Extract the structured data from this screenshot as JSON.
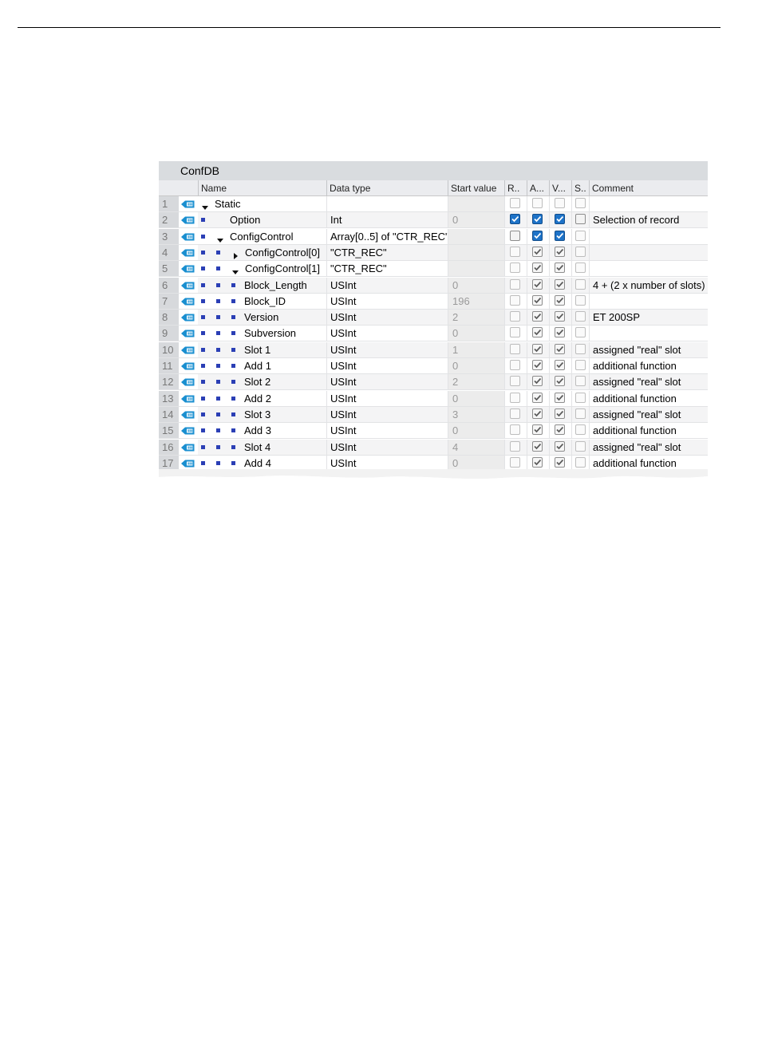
{
  "db": {
    "title": "ConfDB",
    "columns": {
      "name": "Name",
      "data_type": "Data type",
      "start_value": "Start value",
      "c1": "R..",
      "c2": "A...",
      "c3": "V...",
      "c4": "S..",
      "comment": "Comment"
    },
    "rows": [
      {
        "num": "1",
        "name": "Static",
        "dtype": "",
        "start": "",
        "comment": "",
        "level": 0,
        "expand": "down",
        "bullet": false,
        "checks": [
          "off",
          "off",
          "off",
          "off"
        ]
      },
      {
        "num": "2",
        "name": "Option",
        "dtype": "Int",
        "start": "0",
        "comment": "Selection of record",
        "level": 1,
        "expand": "none",
        "bullet": true,
        "checks": [
          "blue",
          "blue",
          "blue",
          "active-off"
        ]
      },
      {
        "num": "3",
        "name": "ConfigControl",
        "dtype": "Array[0..5] of \"CTR_REC\"",
        "start": "",
        "comment": "",
        "level": 1,
        "expand": "down",
        "bullet": true,
        "checks": [
          "active-off",
          "blue",
          "blue",
          "off"
        ]
      },
      {
        "num": "4",
        "name": "ConfigControl[0]",
        "dtype": "\"CTR_REC\"",
        "start": "",
        "comment": "",
        "level": 2,
        "expand": "right",
        "bullet": true,
        "checks": [
          "off",
          "gray",
          "gray",
          "off"
        ]
      },
      {
        "num": "5",
        "name": "ConfigControl[1]",
        "dtype": "\"CTR_REC\"",
        "start": "",
        "comment": "",
        "level": 2,
        "expand": "down",
        "bullet": true,
        "checks": [
          "off",
          "gray",
          "gray",
          "off"
        ]
      },
      {
        "num": "6",
        "name": "Block_Length",
        "dtype": "USInt",
        "start": "0",
        "comment": "4 + (2 x number of slots)",
        "level": 3,
        "expand": "none",
        "bullet": true,
        "checks": [
          "off",
          "gray",
          "gray",
          "off"
        ]
      },
      {
        "num": "7",
        "name": "Block_ID",
        "dtype": "USInt",
        "start": "196",
        "comment": "",
        "level": 3,
        "expand": "none",
        "bullet": true,
        "checks": [
          "off",
          "gray",
          "gray",
          "off"
        ]
      },
      {
        "num": "8",
        "name": "Version",
        "dtype": "USInt",
        "start": "2",
        "comment": "ET 200SP",
        "level": 3,
        "expand": "none",
        "bullet": true,
        "checks": [
          "off",
          "gray",
          "gray",
          "off"
        ]
      },
      {
        "num": "9",
        "name": "Subversion",
        "dtype": "USInt",
        "start": "0",
        "comment": "",
        "level": 3,
        "expand": "none",
        "bullet": true,
        "checks": [
          "off",
          "gray",
          "gray",
          "off"
        ]
      },
      {
        "num": "10",
        "name": "Slot 1",
        "dtype": "USInt",
        "start": "1",
        "comment": "assigned \"real\" slot",
        "level": 3,
        "expand": "none",
        "bullet": true,
        "checks": [
          "off",
          "gray",
          "gray",
          "off"
        ]
      },
      {
        "num": "11",
        "name": "Add 1",
        "dtype": "USInt",
        "start": "0",
        "comment": "additional function",
        "level": 3,
        "expand": "none",
        "bullet": true,
        "checks": [
          "off",
          "gray",
          "gray",
          "off"
        ]
      },
      {
        "num": "12",
        "name": "Slot 2",
        "dtype": "USInt",
        "start": "2",
        "comment": "assigned \"real\" slot",
        "level": 3,
        "expand": "none",
        "bullet": true,
        "checks": [
          "off",
          "gray",
          "gray",
          "off"
        ]
      },
      {
        "num": "13",
        "name": "Add 2",
        "dtype": "USInt",
        "start": "0",
        "comment": "additional function",
        "level": 3,
        "expand": "none",
        "bullet": true,
        "checks": [
          "off",
          "gray",
          "gray",
          "off"
        ]
      },
      {
        "num": "14",
        "name": "Slot 3",
        "dtype": "USInt",
        "start": "3",
        "comment": "assigned \"real\" slot",
        "level": 3,
        "expand": "none",
        "bullet": true,
        "checks": [
          "off",
          "gray",
          "gray",
          "off"
        ]
      },
      {
        "num": "15",
        "name": "Add 3",
        "dtype": "USInt",
        "start": "0",
        "comment": "additional function",
        "level": 3,
        "expand": "none",
        "bullet": true,
        "checks": [
          "off",
          "gray",
          "gray",
          "off"
        ]
      },
      {
        "num": "16",
        "name": "Slot 4",
        "dtype": "USInt",
        "start": "4",
        "comment": "assigned \"real\" slot",
        "level": 3,
        "expand": "none",
        "bullet": true,
        "checks": [
          "off",
          "gray",
          "gray",
          "off"
        ]
      },
      {
        "num": "17",
        "name": "Add 4",
        "dtype": "USInt",
        "start": "0",
        "comment": "additional function",
        "level": 3,
        "expand": "none",
        "bullet": true,
        "checks": [
          "off",
          "gray",
          "gray",
          "off"
        ]
      }
    ]
  },
  "colors": {
    "bullet": "#2b3fb5",
    "checkbox_blue": "#1e73c8",
    "tag_icon": "#1a8fd0"
  },
  "icons": {
    "row_type": "db-tag-icon",
    "expand": "triangle-down-icon",
    "collapse": "triangle-right-icon"
  }
}
